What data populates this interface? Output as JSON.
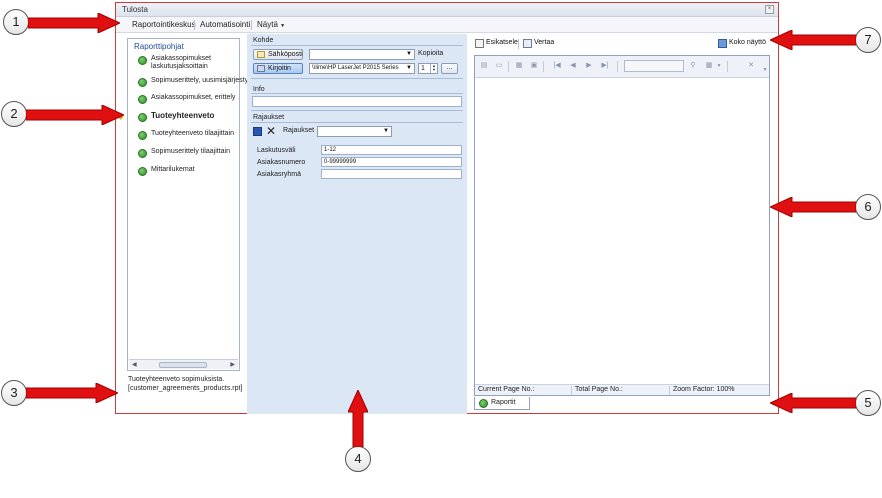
{
  "window": {
    "title": "Tulosta"
  },
  "menubar": {
    "items": [
      "Raportointikeskus",
      "Automatisointi",
      "Näytä"
    ]
  },
  "left": {
    "header": "Raporttipohjat",
    "items": [
      {
        "line1": "Asiakassopimukset",
        "line2": "laskutusjaksoittain"
      },
      {
        "line1": "Sopimuserittely, uusimisjärjestys"
      },
      {
        "line1": "Asiakassopimukset, erittely"
      },
      {
        "line1": "Tuoteyhteenveto"
      },
      {
        "line1": "Tuoteyhteenveto tilaajittain"
      },
      {
        "line1": "Sopimuserittely tilaajittain"
      },
      {
        "line1": "Mittarilukemat"
      }
    ],
    "status_line1": "Tuoteyhteenveto sopimuksista.",
    "status_line2": "[customer_agreements_products.rpt]"
  },
  "middle": {
    "kohde": "Kohde",
    "email_button": "Sähköposti",
    "printer_button": "Kirjoitin",
    "printer_value": "\\\\lime\\HP LaserJet P2015 Series",
    "kopioita": "Kopioita",
    "copies_value": "1",
    "dots": "...",
    "info": "Info",
    "rajaukset": "Rajaukset",
    "rajaukset_label": "Rajaukset",
    "fields": [
      {
        "label": "Laskutusväli",
        "value": "1-12"
      },
      {
        "label": "Asiakasnumero",
        "value": "0-99999999"
      },
      {
        "label": "Asiakasryhmä",
        "value": ""
      }
    ]
  },
  "right": {
    "esikatsele": "Esikatsele",
    "vertaa": "Vertaa",
    "koko_naytto": "Koko näyttö",
    "current_page": "Current Page No.:",
    "total_page": "Total Page No.:",
    "zoom": "Zoom Factor: 100%",
    "tab": "Raportit"
  },
  "callouts": [
    "1",
    "2",
    "3",
    "4",
    "5",
    "6",
    "7"
  ],
  "colors": {
    "arrow": "#e01010",
    "window_border": "#d23a3a",
    "panel_bg": "#dce7f6"
  }
}
